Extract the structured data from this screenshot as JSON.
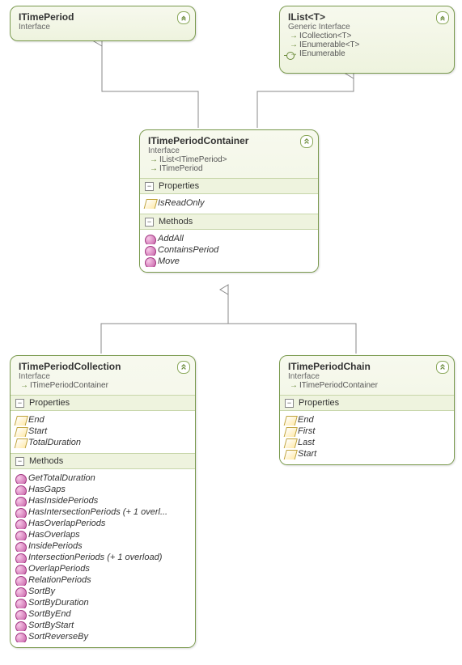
{
  "boxes": {
    "itimeperiod": {
      "title": "ITimePeriod",
      "stereotype": "Interface"
    },
    "ilist": {
      "title": "IList<T>",
      "stereotype": "Generic Interface",
      "inherits": [
        "ICollection<T>",
        "IEnumerable<T>",
        "IEnumerable"
      ]
    },
    "container": {
      "title": "ITimePeriodContainer",
      "stereotype": "Interface",
      "inherits": [
        "IList<ITimePeriod>",
        "ITimePeriod"
      ],
      "sections": {
        "properties_label": "Properties",
        "methods_label": "Methods",
        "properties": [
          "IsReadOnly"
        ],
        "methods": [
          "AddAll",
          "ContainsPeriod",
          "Move"
        ]
      }
    },
    "collection": {
      "title": "ITimePeriodCollection",
      "stereotype": "Interface",
      "inherits": [
        "ITimePeriodContainer"
      ],
      "sections": {
        "properties_label": "Properties",
        "methods_label": "Methods",
        "properties": [
          "End",
          "Start",
          "TotalDuration"
        ],
        "methods": [
          "GetTotalDuration",
          "HasGaps",
          "HasInsidePeriods",
          "HasIntersectionPeriods (+ 1 overl...",
          "HasOverlapPeriods",
          "HasOverlaps",
          "InsidePeriods",
          "IntersectionPeriods (+ 1 overload)",
          "OverlapPeriods",
          "RelationPeriods",
          "SortBy",
          "SortByDuration",
          "SortByEnd",
          "SortByStart",
          "SortReverseBy"
        ]
      }
    },
    "chain": {
      "title": "ITimePeriodChain",
      "stereotype": "Interface",
      "inherits": [
        "ITimePeriodContainer"
      ],
      "sections": {
        "properties_label": "Properties",
        "properties": [
          "End",
          "First",
          "Last",
          "Start"
        ]
      }
    }
  }
}
